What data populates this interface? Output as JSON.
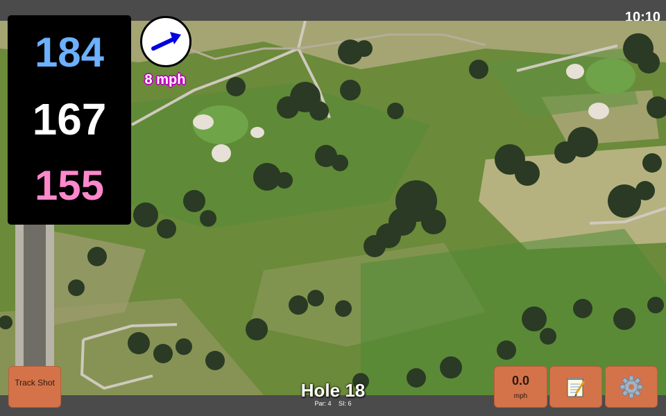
{
  "status": {
    "time": "10:10"
  },
  "distances": {
    "back": "184",
    "middle": "167",
    "front": "155"
  },
  "wind": {
    "speed_label": "8 mph",
    "direction_icon": "arrow-up-right-icon"
  },
  "hole": {
    "title": "Hole 18",
    "par_label": "Par: 4",
    "si_label": "SI: 6"
  },
  "buttons": {
    "track_shot": "Track Shot",
    "speed_value": "0.0",
    "speed_unit": "mph",
    "notes_icon": "notepad-icon",
    "settings_icon": "gear-icon"
  },
  "colors": {
    "back_distance": "#6cb0ff",
    "middle_distance": "#ffffff",
    "front_distance": "#ff88cc",
    "button_bg": "#d4734a",
    "wind_arrow": "#0000e0",
    "wind_label_outline": "#c000c0"
  }
}
